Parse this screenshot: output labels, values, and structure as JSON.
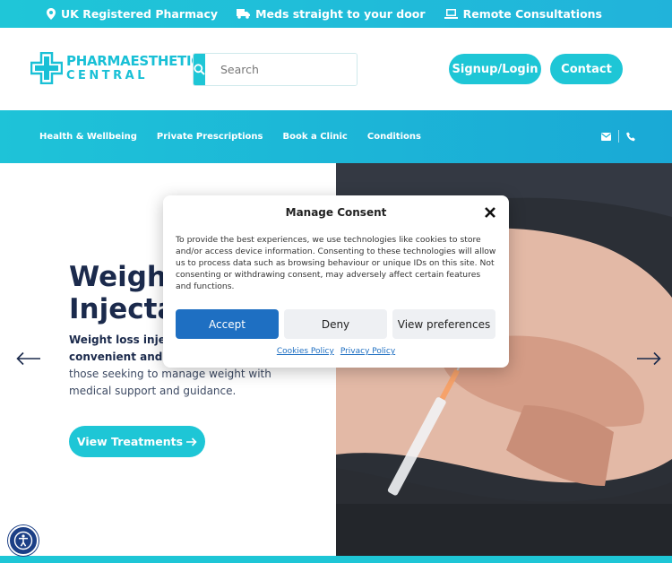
{
  "topbar": {
    "items": [
      {
        "label": "UK Registered Pharmacy",
        "icon": "map-pin-icon"
      },
      {
        "label": "Meds straight to your door",
        "icon": "truck-icon"
      },
      {
        "label": "Remote Consultations",
        "icon": "laptop-icon"
      }
    ]
  },
  "header": {
    "logo_line1": "PHARMAESTHETICS",
    "logo_line2": "CENTRAL",
    "search_placeholder": "Search",
    "signup_label": "Signup/Login",
    "contact_label": "Contact"
  },
  "nav": {
    "items": [
      "Health & Wellbeing",
      "Private Prescriptions",
      "Book a Clinic",
      "Conditions"
    ],
    "icons": [
      "envelope-icon",
      "phone-icon"
    ]
  },
  "hero": {
    "title_line1": "Weight",
    "title_line2": "Injectal",
    "text_bold_1": "Weight loss injecto",
    "text_bold_2": "convenient and ef",
    "text_rest_1": "those seeking to manage weight with",
    "text_rest_2": "medical support and guidance.",
    "button_label": "View Treatments"
  },
  "consent": {
    "title": "Manage Consent",
    "body": "To provide the best experiences, we use technologies like cookies to store and/or access device information. Consenting to these technologies will allow us to process data such as browsing behaviour or unique IDs on this site. Not consenting or withdrawing consent, may adversely affect certain features and functions.",
    "accept_label": "Accept",
    "deny_label": "Deny",
    "prefs_label": "View preferences",
    "cookies_link": "Cookies Policy",
    "privacy_link": "Privacy Policy"
  },
  "colors": {
    "brand_teal": "#1ec6d6",
    "navy_text": "#1b2a4c",
    "accept_blue": "#1e6fc2"
  }
}
